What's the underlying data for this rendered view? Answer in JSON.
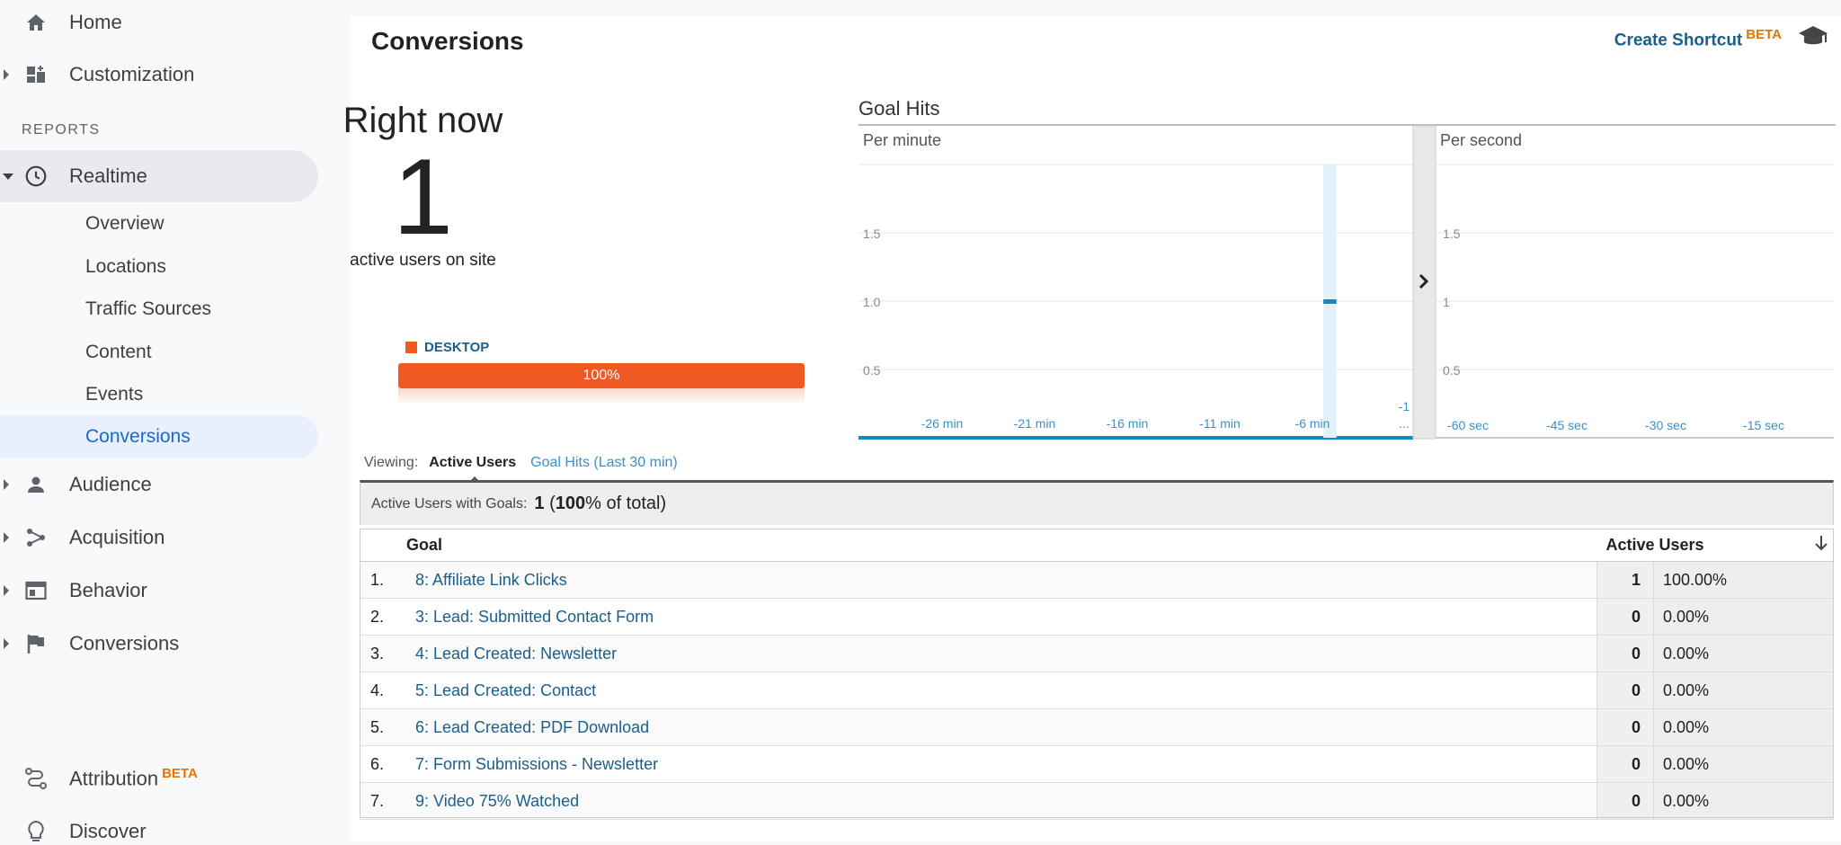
{
  "sidebar": {
    "top_items": [
      {
        "label": "Home",
        "icon": "home-icon"
      },
      {
        "label": "Customization",
        "icon": "dashboard-icon"
      }
    ],
    "reports_header": "REPORTS",
    "realtime": {
      "label": "Realtime",
      "icon": "clock-icon"
    },
    "realtime_sub": [
      "Overview",
      "Locations",
      "Traffic Sources",
      "Content",
      "Events",
      "Conversions"
    ],
    "sections": [
      {
        "label": "Audience",
        "icon": "person-icon"
      },
      {
        "label": "Acquisition",
        "icon": "acquisition-icon"
      },
      {
        "label": "Behavior",
        "icon": "behavior-icon"
      },
      {
        "label": "Conversions",
        "icon": "flag-icon"
      }
    ],
    "attribution": {
      "label": "Attribution",
      "badge": "BETA",
      "icon": "attribution-icon"
    },
    "discover": {
      "label": "Discover",
      "icon": "lightbulb-icon"
    }
  },
  "header": {
    "title": "Conversions",
    "shortcut_label": "Create Shortcut",
    "shortcut_badge": "BETA"
  },
  "right_now": {
    "title": "Right now",
    "count": "1",
    "subtitle": "active users on site",
    "device_label": "DESKTOP",
    "device_percent": "100%",
    "device_share": 1.0,
    "device_color": "#f05a22"
  },
  "goal_hits": {
    "title": "Goal Hits",
    "per_minute_label": "Per minute",
    "per_second_label": "Per second"
  },
  "chart_data": [
    {
      "type": "bar",
      "title": "Per minute",
      "y_ticks": [
        "1.5",
        "1.0",
        "0.5"
      ],
      "x_ticks": [
        "-26 min",
        "-21 min",
        "-16 min",
        "-11 min",
        "-6 min",
        "-1 ..."
      ],
      "ylim": [
        0,
        2
      ],
      "categories": [
        "-30",
        "-29",
        "-28",
        "-27",
        "-26",
        "-25",
        "-24",
        "-23",
        "-22",
        "-21",
        "-20",
        "-19",
        "-18",
        "-17",
        "-16",
        "-15",
        "-14",
        "-13",
        "-12",
        "-11",
        "-10",
        "-9",
        "-8",
        "-7",
        "-6",
        "-5",
        "-4",
        "-3",
        "-2",
        "-1"
      ],
      "values": [
        0,
        0,
        0,
        0,
        0,
        0,
        0,
        0,
        0,
        0,
        0,
        0,
        0,
        0,
        0,
        0,
        0,
        0,
        0,
        0,
        0,
        0,
        0,
        0,
        0,
        1,
        0,
        0,
        0,
        0
      ],
      "highlight_index": 25,
      "color": "#058dc7"
    },
    {
      "type": "bar",
      "title": "Per second",
      "y_ticks": [
        "1.5",
        "1",
        "0.5"
      ],
      "x_ticks": [
        "-60 sec",
        "-45 sec",
        "-30 sec",
        "-15 sec"
      ],
      "ylim": [
        0,
        2
      ],
      "values": []
    }
  ],
  "viewing": {
    "label": "Viewing:",
    "active_tab": "Active Users",
    "other_tab": "Goal Hits (Last 30 min)"
  },
  "summary": {
    "label": "Active Users with Goals:",
    "value_count": "1",
    "value_pct": "100",
    "value_rest": "% of total)"
  },
  "table": {
    "col_goal": "Goal",
    "col_users": "Active Users",
    "rows": [
      {
        "idx": "1.",
        "goal": "8: Affiliate Link Clicks",
        "users": "1",
        "pct": "100.00%"
      },
      {
        "idx": "2.",
        "goal": "3: Lead: Submitted Contact Form",
        "users": "0",
        "pct": "0.00%"
      },
      {
        "idx": "3.",
        "goal": "4: Lead Created: Newsletter",
        "users": "0",
        "pct": "0.00%"
      },
      {
        "idx": "4.",
        "goal": "5: Lead Created: Contact",
        "users": "0",
        "pct": "0.00%"
      },
      {
        "idx": "5.",
        "goal": "6: Lead Created: PDF Download",
        "users": "0",
        "pct": "0.00%"
      },
      {
        "idx": "6.",
        "goal": "7: Form Submissions - Newsletter",
        "users": "0",
        "pct": "0.00%"
      },
      {
        "idx": "7.",
        "goal": "9: Video 75% Watched",
        "users": "0",
        "pct": "0.00%"
      }
    ]
  }
}
